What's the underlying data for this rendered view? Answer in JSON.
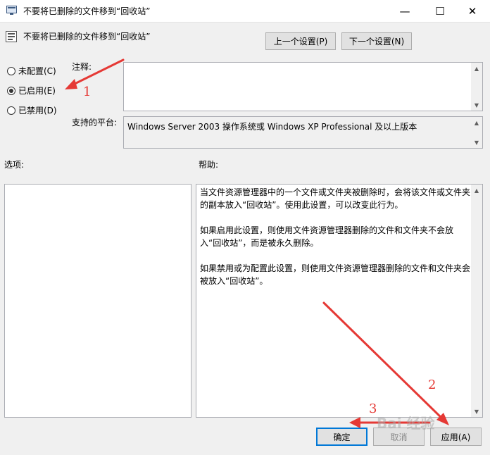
{
  "window": {
    "title": "不要将已删除的文件移到“回收站”",
    "controls": {
      "minimize": "—",
      "maximize": "☐",
      "close": "✕"
    }
  },
  "header": {
    "policy_title": "不要将已删除的文件移到“回收站”",
    "prev_button": "上一个设置(P)",
    "next_button": "下一个设置(N)"
  },
  "state_options": [
    {
      "label": "未配置(C)",
      "checked": false
    },
    {
      "label": "已启用(E)",
      "checked": true
    },
    {
      "label": "已禁用(D)",
      "checked": false
    }
  ],
  "comment": {
    "label": "注释:",
    "value": ""
  },
  "platform": {
    "label": "支持的平台:",
    "value": "Windows Server 2003 操作系统或 Windows XP Professional 及以上版本"
  },
  "options_label": "选项:",
  "help": {
    "label": "帮助:",
    "paragraphs": [
      "当文件资源管理器中的一个文件或文件夹被删除时，会将该文件或文件夹的副本放入“回收站”。使用此设置，可以改变此行为。",
      "如果启用此设置，则使用文件资源管理器删除的文件和文件夹不会放入“回收站”，而是被永久删除。",
      "如果禁用或为配置此设置，则使用文件资源管理器删除的文件和文件夹会被放入“回收站”。"
    ]
  },
  "footer": {
    "ok": "确定",
    "cancel": "取消",
    "apply": "应用(A)"
  },
  "annotations": [
    "1",
    "2",
    "3"
  ],
  "watermark": "Bai 经验",
  "colors": {
    "annotation": "#e53935",
    "focus_border": "#0078d7"
  }
}
